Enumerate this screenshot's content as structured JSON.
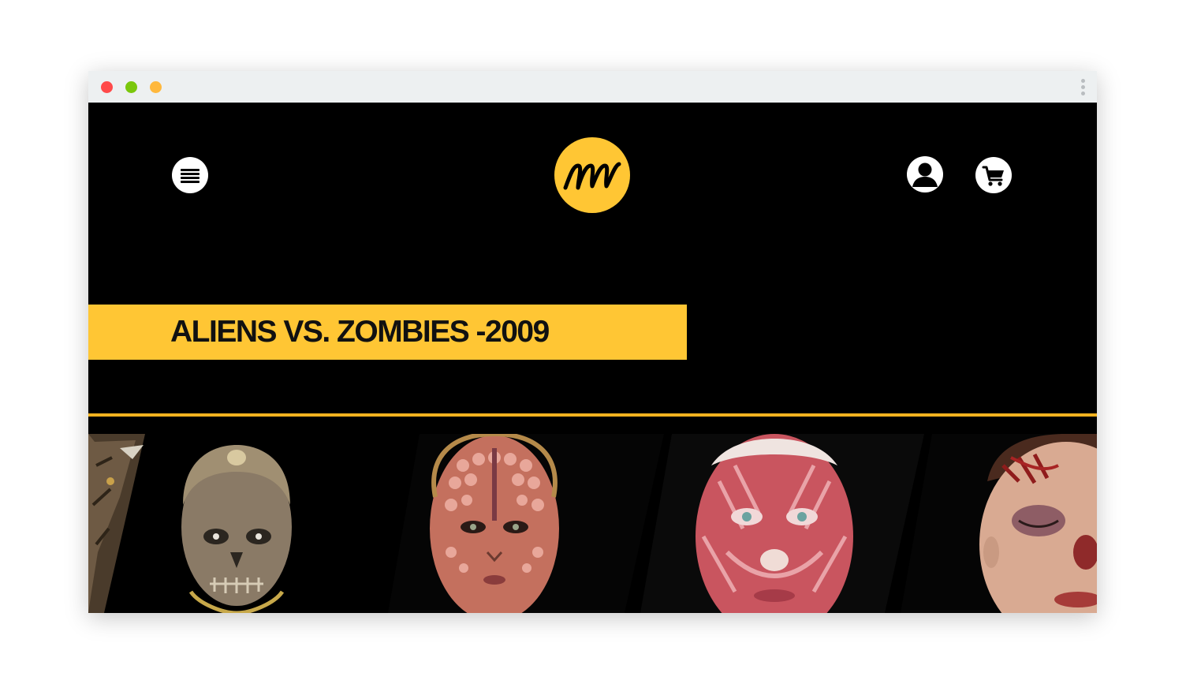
{
  "header": {
    "menu_icon": "hamburger-menu-icon",
    "logo_text": "mm",
    "account_icon": "user-account-icon",
    "cart_icon": "shopping-cart-icon"
  },
  "hero": {
    "title": "ALIENS VS. ZOMBIES -2009"
  },
  "gallery": {
    "items": [
      "reptile-creature-makeup",
      "zombie-skull-makeup",
      "alien-scales-makeup",
      "muscle-anatomy-makeup",
      "wound-bruise-makeup"
    ]
  },
  "colors": {
    "accent": "#ffc634",
    "divider": "#f1b21f",
    "background": "#000000"
  }
}
